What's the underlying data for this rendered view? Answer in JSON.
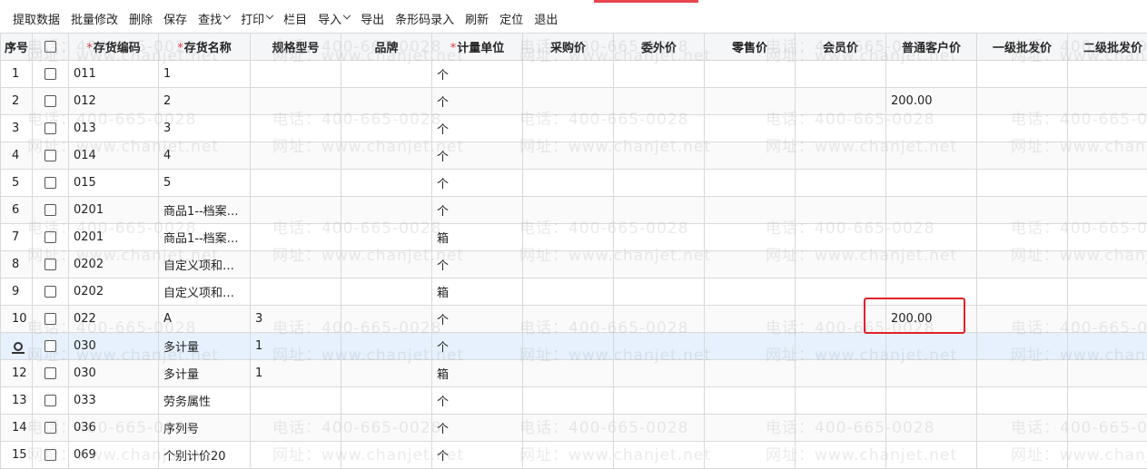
{
  "toolbar": {
    "items": [
      {
        "label": "提取数据",
        "dropdown": false
      },
      {
        "label": "批量修改",
        "dropdown": false
      },
      {
        "label": "删除",
        "dropdown": false
      },
      {
        "label": "保存",
        "dropdown": false
      },
      {
        "label": "查找",
        "dropdown": true
      },
      {
        "label": "打印",
        "dropdown": true
      },
      {
        "label": "栏目",
        "dropdown": false
      },
      {
        "label": "导入",
        "dropdown": true
      },
      {
        "label": "导出",
        "dropdown": false
      },
      {
        "label": "条形码录入",
        "dropdown": false
      },
      {
        "label": "刷新",
        "dropdown": false
      },
      {
        "label": "定位",
        "dropdown": false
      },
      {
        "label": "退出",
        "dropdown": false
      }
    ]
  },
  "table": {
    "columns": [
      {
        "label": "序号",
        "required": false
      },
      {
        "label": "",
        "required": false,
        "checkbox": true
      },
      {
        "label": "存货编码",
        "required": true
      },
      {
        "label": "存货名称",
        "required": true
      },
      {
        "label": "规格型号",
        "required": false
      },
      {
        "label": "品牌",
        "required": false
      },
      {
        "label": "计量单位",
        "required": true
      },
      {
        "label": "采购价",
        "required": false
      },
      {
        "label": "委外价",
        "required": false
      },
      {
        "label": "零售价",
        "required": false
      },
      {
        "label": "会员价",
        "required": false
      },
      {
        "label": "普通客户价",
        "required": false
      },
      {
        "label": "一级批发价",
        "required": false
      },
      {
        "label": "二级批发价",
        "required": false
      }
    ],
    "rows": [
      {
        "seq": "1",
        "code": "011",
        "name": "1",
        "spec": "",
        "brand": "",
        "unit": "个",
        "normal_price": "",
        "active": false
      },
      {
        "seq": "2",
        "code": "012",
        "name": "2",
        "spec": "",
        "brand": "",
        "unit": "个",
        "normal_price": "200.00",
        "active": false
      },
      {
        "seq": "3",
        "code": "013",
        "name": "3",
        "spec": "",
        "brand": "",
        "unit": "个",
        "normal_price": "",
        "active": false
      },
      {
        "seq": "4",
        "code": "014",
        "name": "4",
        "spec": "",
        "brand": "",
        "unit": "个",
        "normal_price": "",
        "active": false
      },
      {
        "seq": "5",
        "code": "015",
        "name": "5",
        "spec": "",
        "brand": "",
        "unit": "个",
        "normal_price": "",
        "active": false
      },
      {
        "seq": "6",
        "code": "0201",
        "name": "商品1--档案…",
        "spec": "",
        "brand": "",
        "unit": "个",
        "normal_price": "",
        "active": false
      },
      {
        "seq": "7",
        "code": "0201",
        "name": "商品1--档案…",
        "spec": "",
        "brand": "",
        "unit": "箱",
        "normal_price": "",
        "active": false
      },
      {
        "seq": "8",
        "code": "0202",
        "name": "自定义项和…",
        "spec": "",
        "brand": "",
        "unit": "个",
        "normal_price": "",
        "active": false
      },
      {
        "seq": "9",
        "code": "0202",
        "name": "自定义项和…",
        "spec": "",
        "brand": "",
        "unit": "箱",
        "normal_price": "",
        "active": false
      },
      {
        "seq": "10",
        "code": "022",
        "name": "A",
        "spec": "3",
        "brand": "",
        "unit": "个",
        "normal_price": "200.00",
        "active": false
      },
      {
        "seq": "",
        "code": "030",
        "name": "多计量",
        "spec": "1",
        "brand": "",
        "unit": "个",
        "normal_price": "",
        "active": true
      },
      {
        "seq": "12",
        "code": "030",
        "name": "多计量",
        "spec": "1",
        "brand": "",
        "unit": "箱",
        "normal_price": "",
        "active": false
      },
      {
        "seq": "13",
        "code": "033",
        "name": "劳务属性",
        "spec": "",
        "brand": "",
        "unit": "个",
        "normal_price": "",
        "active": false
      },
      {
        "seq": "14",
        "code": "036",
        "name": "序列号",
        "spec": "",
        "brand": "",
        "unit": "个",
        "normal_price": "",
        "active": false
      },
      {
        "seq": "15",
        "code": "069",
        "name": "个别计价20",
        "spec": "",
        "brand": "",
        "unit": "个",
        "normal_price": "",
        "active": false
      }
    ]
  },
  "watermark": {
    "phone": "电话：400-665-0028",
    "url": "网址：www.chanjet.net"
  },
  "colors": {
    "accent_red": "#e0222a",
    "active_row": "#e6f1fd",
    "required_mark": "#e4393c"
  }
}
